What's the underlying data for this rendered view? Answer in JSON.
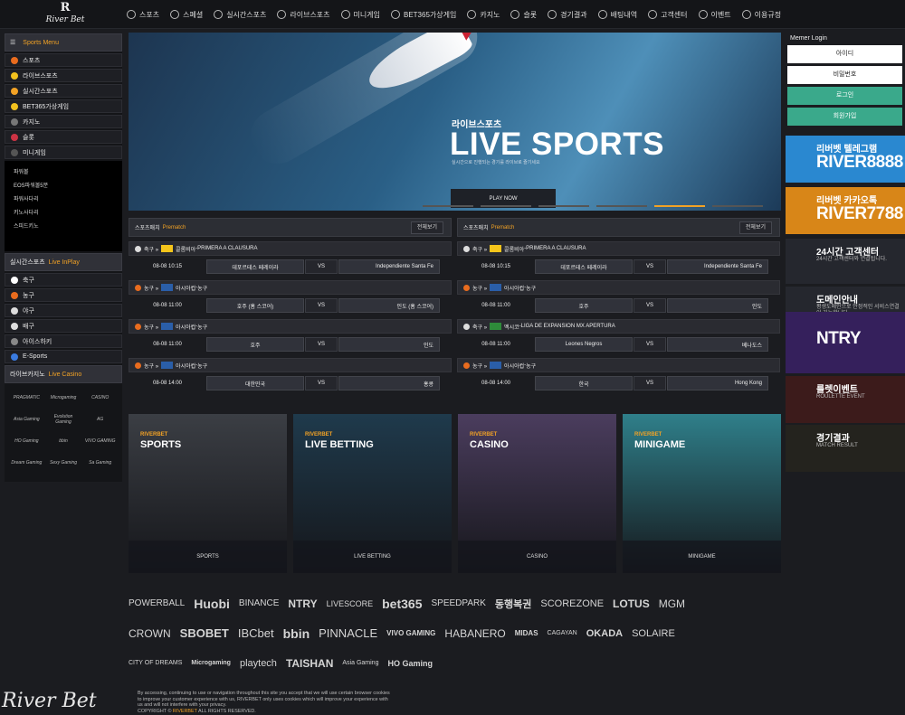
{
  "brand": {
    "mark": "R",
    "name": "River Bet",
    "signature": "River Bet"
  },
  "nav": [
    "스포츠",
    "스페셜",
    "실시간스포츠",
    "라이브스포츠",
    "미니게임",
    "BET365가상게임",
    "카지노",
    "슬롯",
    "경기결과",
    "배팅내역",
    "고객센터",
    "이벤트",
    "이용규정"
  ],
  "nav_icons": [
    "soccer-ball-icon",
    "special-ball-icon",
    "live-sports-icon",
    "live-broadcast-icon",
    "mini-game-icon",
    "trophy-icon",
    "casino-chip-icon",
    "slot-icon",
    "results-icon",
    "betting-history-icon",
    "support-icon",
    "diamond-icon",
    "rules-icon"
  ],
  "sports_menu": {
    "title": "Sports Menu",
    "items": [
      {
        "label": "스포츠",
        "color": "#e96c1e"
      },
      {
        "label": "라이브스포츠",
        "color": "#f2c11e"
      },
      {
        "label": "실시간스포츠",
        "color": "#f2a225"
      },
      {
        "label": "BET365가상게임",
        "color": "#f2c11e"
      },
      {
        "label": "카지노",
        "color": "#777777"
      },
      {
        "label": "슬롯",
        "color": "#cc3344"
      },
      {
        "label": "미니게임",
        "color": "#555555"
      }
    ]
  },
  "minigame_list": [
    "파워볼",
    "EOS파워볼5분",
    "파워사다리",
    "키노사다리",
    "스피드키노"
  ],
  "inplay": {
    "title": "실시간스포츠",
    "accent": "Live InPlay",
    "items": [
      {
        "label": "축구",
        "color": "#ffffff"
      },
      {
        "label": "농구",
        "color": "#e96c1e"
      },
      {
        "label": "야구",
        "color": "#dddddd"
      },
      {
        "label": "배구",
        "color": "#dddddd"
      },
      {
        "label": "아이스하키",
        "color": "#888888"
      },
      {
        "label": "E-Sports",
        "color": "#3a7be0"
      }
    ]
  },
  "live_casino": {
    "title": "라이브카지노",
    "accent": "Live Casino",
    "providers": [
      "PRAGMATIC",
      "Microgaming",
      "CASINO",
      "Asia Gaming",
      "Evolution Gaming",
      "AG",
      "HO Gaming",
      "bbin",
      "VIVO GAMING",
      "Dream Gaming",
      "Sexy Gaming",
      "Sa Gaming"
    ]
  },
  "banner": {
    "subtitle": "라이브스포츠",
    "title": "LIVE SPORTS",
    "body": "실시간으로 진행되는 경기를 라이브로 즐기세요",
    "button": "PLAY NOW"
  },
  "prematch": [
    {
      "title": "스포츠매치",
      "accent": "Prematch",
      "all": "전체보기",
      "leagues": [
        {
          "sport": "축구 »",
          "country": "콜롬비아",
          "league": "PRIMERA A CLAUSURA",
          "time": "08-08 10:15",
          "home": "데포르테스 페레이라",
          "vs": "VS",
          "away": "Independiente Santa Fe",
          "icon": "#dddddd",
          "flag": "#f5c51b"
        },
        {
          "sport": "농구 »",
          "country": "아시아컵",
          "league": "농구",
          "time": "08-08 11:00",
          "home": "호주 (홈 스코어)",
          "vs": "VS",
          "away": "인도 (홈 스코어)",
          "icon": "#e96c1e",
          "flag": "#2a5ea8"
        },
        {
          "sport": "농구 »",
          "country": "아시아컵",
          "league": "농구",
          "time": "08-08 11:00",
          "home": "호주",
          "vs": "VS",
          "away": "인도",
          "icon": "#e96c1e",
          "flag": "#2a5ea8"
        },
        {
          "sport": "농구 »",
          "country": "아시아컵",
          "league": "농구",
          "time": "08-08 14:00",
          "home": "대한민국",
          "vs": "VS",
          "away": "홍콩",
          "icon": "#e96c1e",
          "flag": "#2a5ea8"
        }
      ]
    },
    {
      "title": "스포츠매치",
      "accent": "Prematch",
      "all": "전체보기",
      "leagues": [
        {
          "sport": "축구 »",
          "country": "콜롬비아",
          "league": "PRIMERA A CLAUSURA",
          "time": "08-08 10:15",
          "home": "데포르테스 페레이라",
          "vs": "VS",
          "away": "Independiente Santa Fe",
          "icon": "#dddddd",
          "flag": "#f5c51b"
        },
        {
          "sport": "농구 »",
          "country": "아시아컵",
          "league": "농구",
          "time": "08-08 11:00",
          "home": "호주",
          "vs": "VS",
          "away": "인도",
          "icon": "#e96c1e",
          "flag": "#2a5ea8"
        },
        {
          "sport": "축구 »",
          "country": "멕시코",
          "league": "LIGA DE EXPANSION MX APERTURA",
          "time": "08-08 11:00",
          "home": "Leones Negros",
          "vs": "VS",
          "away": "베나도스",
          "icon": "#dddddd",
          "flag": "#2e8b3a"
        },
        {
          "sport": "농구 »",
          "country": "아시아컵",
          "league": "농구",
          "time": "08-08 14:00",
          "home": "한국",
          "vs": "VS",
          "away": "Hong Kong",
          "icon": "#e96c1e",
          "flag": "#2a5ea8"
        }
      ]
    }
  ],
  "cards": [
    {
      "tag": "RIVERBET",
      "title": "SPORTS",
      "footer": "SPORTS",
      "bg": "#3b3e44"
    },
    {
      "tag": "RIVERBET",
      "title": "LIVE BETTING",
      "footer": "LIVE BETTING",
      "bg": "#1f3a4c"
    },
    {
      "tag": "RIVERBET",
      "title": "CASINO",
      "footer": "CASINO",
      "bg": "#4b3d5e"
    },
    {
      "tag": "RIVERBET",
      "title": "MINIGAME",
      "footer": "MINIGAME",
      "bg": "#2f7f8a"
    }
  ],
  "login": {
    "title": "Memer Login",
    "id": "아이디",
    "pw": "비밀번호",
    "login": "로그인",
    "join": "회원가입"
  },
  "right_banners": [
    {
      "small": "리버벳 텔레그램",
      "big": "RIVER8888",
      "bg": "#2a88d0"
    },
    {
      "small": "리버벳 카카오톡",
      "big": "RIVER7788",
      "bg": "#d88618"
    },
    {
      "small": "24시간 고객센터",
      "big": "",
      "bg": "#25272e",
      "line": "24시간 고객센터와 연결됩니다."
    },
    {
      "small": "도메인안내",
      "big": "",
      "bg": "#25272e",
      "line": "평생도메인으로 안정적인 서비스연결이 가능합니다."
    },
    {
      "small": "",
      "big": "NTRY",
      "bg": "#35205c"
    },
    {
      "small": "룰렛이벤트",
      "big": "",
      "bg": "#3c1b1b",
      "line": "ROULETTE EVENT"
    },
    {
      "small": "경기결과",
      "big": "",
      "bg": "#24231e",
      "line": "MATCH RESULT"
    }
  ],
  "partners": [
    [
      "POWERBALL",
      "Huobi",
      "BINANCE",
      "NTRY",
      "LIVESCORE",
      "bet365",
      "SPEEDPARK",
      "동행복권",
      "SCOREZONE",
      "LOTUS",
      "MGM"
    ],
    [
      "CROWN",
      "SBOBET",
      "IBCbet",
      "bbin",
      "PINNACLE",
      "VIVO GAMING",
      "HABANERO",
      "MIDAS",
      "CAGAYAN",
      "OKADA",
      "SOLAIRE"
    ],
    [
      "CITY OF DREAMS",
      "Microgaming",
      "playtech",
      "TAISHAN",
      "Asia Gaming",
      "HO Gaming"
    ]
  ],
  "footer": {
    "line1": "By accessing, continuing to use or navigation throughout this site you accept that we will use certain browser cookies",
    "line2": "to improve your customer experience with us, RIVERBET only uses cookies which will improve your experience with",
    "line3": "us and will not interfere with your privacy.",
    "copyright": "COPYRIGHT ©",
    "brand": "RIVERBET",
    "rights": "ALL RIGHTS RESERVED."
  }
}
